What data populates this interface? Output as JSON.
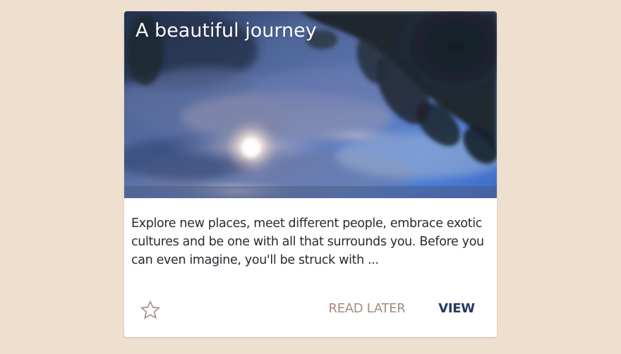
{
  "card": {
    "title": "A beautiful journey",
    "description": "Explore new places, meet different people, embrace exotic cultures and be one with all that surrounds you. Before you can even imagine, you'll be struck with ...",
    "image_subject": "sunlit blue sky with clouds and dark leaves",
    "actions": {
      "favorite_icon": "star-outline-icon",
      "read_later_label": "READ LATER",
      "view_label": "VIEW"
    }
  },
  "colors": {
    "page_background": "#efdfcf",
    "card_background": "#ffffff",
    "title_text": "#ffffff",
    "body_text": "#2a2a34",
    "read_later_text": "#a68b80",
    "view_text": "#273760",
    "star_outline": "#a68b80"
  }
}
